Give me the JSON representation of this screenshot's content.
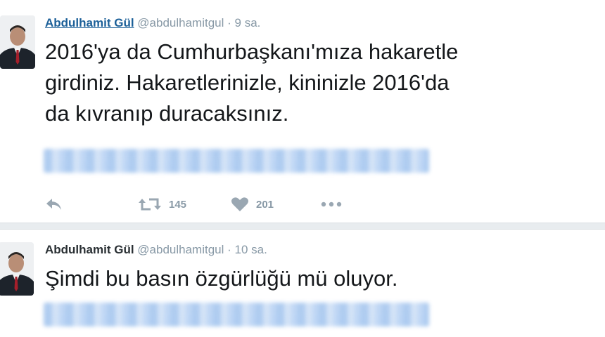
{
  "tweets": [
    {
      "author": {
        "display_name": "Abdulhamit Gül",
        "handle": "@abdulhamitgul"
      },
      "separator": "·",
      "time": "9 sa.",
      "lines": [
        "2016'ya da Cumhurbaşkanı'mıza hakaretle",
        "girdiniz. Hakaretlerinizle, kininizle 2016'da",
        "da kıvranıp duracaksınız."
      ],
      "actions": {
        "reply_icon": "reply-icon",
        "retweet_icon": "retweet-icon",
        "retweet_count": "145",
        "like_icon": "heart-icon",
        "like_count": "201",
        "more_icon": "more-icon"
      }
    },
    {
      "author": {
        "display_name": "Abdulhamit Gül",
        "handle": "@abdulhamitgul"
      },
      "separator": "·",
      "time": "10 sa.",
      "lines": [
        "Şimdi bu basın özgürlüğü mü oluyor."
      ]
    }
  ],
  "colors": {
    "name_link": "#1b5f98",
    "muted": "#8899a6",
    "text": "#14171a",
    "background": "#ffffff"
  }
}
